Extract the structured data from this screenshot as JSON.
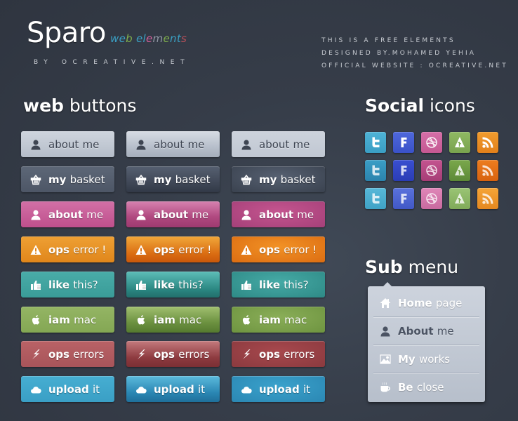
{
  "header": {
    "logo": "Sparo",
    "logo_sub_letters": [
      {
        "ch": "w",
        "color": "#3aa0c4"
      },
      {
        "ch": "e",
        "color": "#3aa0c4"
      },
      {
        "ch": "b",
        "color": "#7fae4c"
      },
      {
        "ch": " ",
        "color": "#ffffff"
      },
      {
        "ch": "e",
        "color": "#3aa0c4"
      },
      {
        "ch": "l",
        "color": "#3aa0c4"
      },
      {
        "ch": "e",
        "color": "#d4609c"
      },
      {
        "ch": "m",
        "color": "#8f96a3"
      },
      {
        "ch": "e",
        "color": "#7fae4c"
      },
      {
        "ch": "n",
        "color": "#3aa0c4"
      },
      {
        "ch": "t",
        "color": "#3aa0c4"
      },
      {
        "ch": "s",
        "color": "#b9505a"
      }
    ],
    "byline": "BY OCREATIVE.NET",
    "info": [
      "THIS IS A FREE ELEMENTS",
      "DESIGNED BY.MOHAMED YEHIA",
      "OFFICIAL WEBSITE : OCREATIVE.NET"
    ]
  },
  "sections": {
    "buttons_title_bold": "web",
    "buttons_title_light": "buttons",
    "social_title_bold": "Social",
    "social_title_light": "icons",
    "submenu_title_bold": "Sub",
    "submenu_title_light": "menu"
  },
  "button_rows": [
    {
      "icon": "user-icon",
      "w1": "about",
      "w2": "me",
      "theme": "grey"
    },
    {
      "icon": "basket-icon",
      "w1": "my",
      "w2": "basket",
      "theme": "slate"
    },
    {
      "icon": "user-icon",
      "w1": "about",
      "w2": "me",
      "theme": "pink"
    },
    {
      "icon": "warning-icon",
      "w1": "ops",
      "w2": "error !",
      "theme": "orange"
    },
    {
      "icon": "thumbs-up-icon",
      "w1": "like",
      "w2": "this?",
      "theme": "teal"
    },
    {
      "icon": "apple-icon",
      "w1": "iam",
      "w2": "mac",
      "theme": "green"
    },
    {
      "icon": "lightning-icon",
      "w1": "ops",
      "w2": "errors",
      "theme": "red"
    },
    {
      "icon": "cloud-icon",
      "w1": "upload",
      "w2": "it",
      "theme": "blue"
    }
  ],
  "social_icons": [
    "twitter",
    "facebook",
    "dribbble",
    "forrst",
    "rss"
  ],
  "submenu": {
    "items": [
      {
        "icon": "home-icon",
        "w1": "Home",
        "w2": "page",
        "style": "light"
      },
      {
        "icon": "user-icon",
        "w1": "About",
        "w2": "me",
        "style": "dark"
      },
      {
        "icon": "image-icon",
        "w1": "My",
        "w2": "works",
        "style": "light"
      },
      {
        "icon": "coffee-icon",
        "w1": "Be",
        "w2": "close",
        "style": "light"
      }
    ]
  }
}
